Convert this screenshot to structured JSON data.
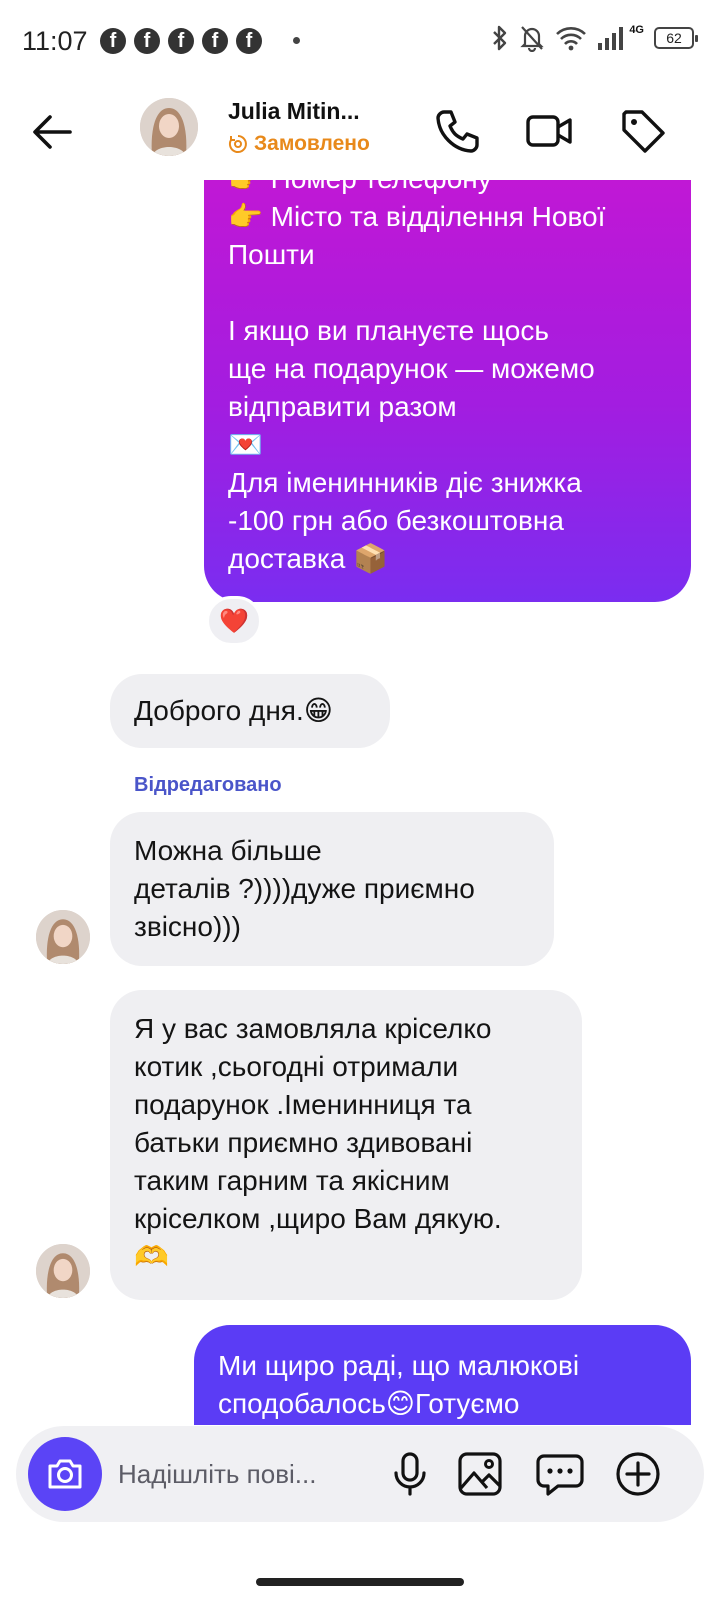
{
  "status_bar": {
    "time": "11:07",
    "network": "4G",
    "battery": "62"
  },
  "header": {
    "name": "Julia Mitin...",
    "status": "Замовлено"
  },
  "messages": {
    "outgoing_gradient": [
      "👉 Номер телефону",
      "👉 Місто та відділення Нової",
      "Пошти",
      "",
      "І якщо ви плануєте щось",
      "ще на подарунок — можемо",
      "відправити разом",
      "💌",
      "Для іменинників діє знижка",
      "-100 грн або безкоштовна",
      "доставка 📦"
    ],
    "reaction": "❤️",
    "incoming_1": "Доброго дня.😁",
    "edited_label": "Відредаговано",
    "incoming_2": [
      "Можна більше",
      "деталів ?))))дуже приємно",
      "звісно)))"
    ],
    "incoming_3": [
      "Я у вас замовляла кріселко",
      "котик ,сьогодні отримали",
      "подарунок .Іменинниця та",
      "батьки приємно здивовані",
      "таким гарним та якісним",
      "кріселком ,щиро Вам дякую.",
      "🫶"
    ],
    "outgoing_last": [
      "Ми щиро раді, що  малюкові",
      "сподобалось😊Готуємо"
    ]
  },
  "composer": {
    "placeholder": "Надішліть пові..."
  },
  "icons": {
    "back": "arrow-left-icon",
    "call": "phone-icon",
    "video": "video-camera-icon",
    "tag": "tag-icon",
    "camera": "camera-icon",
    "mic": "microphone-icon",
    "gallery": "image-icon",
    "sticker": "chat-bubble-icon",
    "add": "plus-circle-icon"
  },
  "colors": {
    "accent": "#5b44f6",
    "status_orange": "#e8891a",
    "edited_blue": "#4a55c9"
  }
}
